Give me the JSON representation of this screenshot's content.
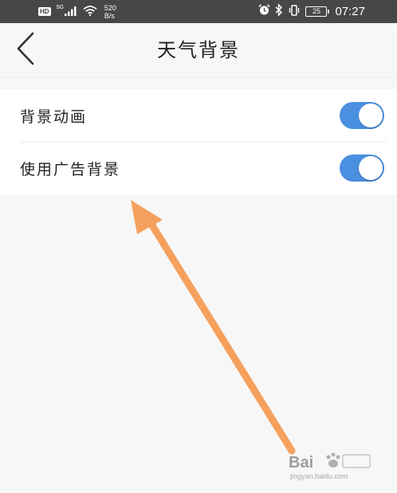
{
  "status_bar": {
    "hd_label": "HD",
    "network_type": "5G",
    "speed_value": "520",
    "speed_unit": "B/s",
    "battery_level": "25",
    "time": "07:27",
    "icons": [
      "signal-icon",
      "wifi-icon",
      "alarm-icon",
      "bluetooth-icon",
      "vibrate-icon",
      "battery-icon"
    ]
  },
  "header": {
    "title": "天气背景",
    "back_icon": "chevron-left-icon"
  },
  "settings": {
    "items": [
      {
        "label": "背景动画",
        "enabled": true
      },
      {
        "label": "使用广告背景",
        "enabled": true
      }
    ]
  },
  "colors": {
    "status_bar_bg": "#474747",
    "page_bg": "#f7f7f7",
    "toggle_on": "#4a8fe0",
    "annotation_arrow": "#f5a05c"
  },
  "watermark": {
    "brand": "Bai",
    "site": "jingyan.baidu.com"
  }
}
